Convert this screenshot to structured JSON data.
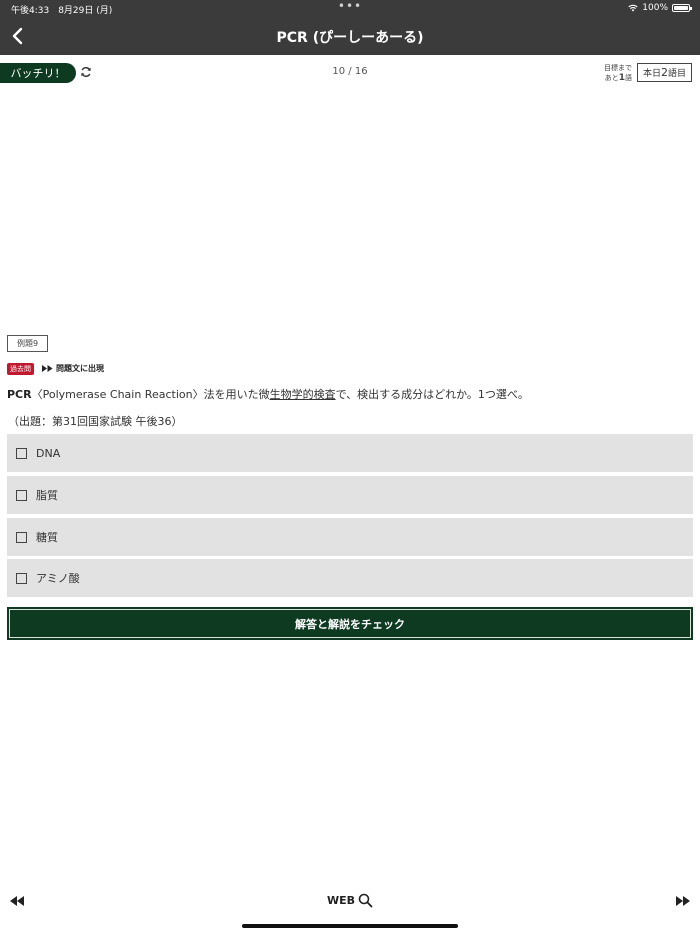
{
  "status_bar": {
    "time_date": "午後4:33　8月29日 (月)",
    "dots": "•••",
    "battery": "100%"
  },
  "nav": {
    "title": "PCR (ぴーしーあーる)"
  },
  "subbar": {
    "batchiri_label": "バッチリ！",
    "progress": "10 / 16",
    "goal_prefix": "目標まで",
    "goal_line2_a": "あと",
    "goal_remaining": "1",
    "goal_line2_b": "語",
    "today_prefix": "本日",
    "today_count": "2",
    "today_suffix": "語目"
  },
  "question": {
    "example_label": "例題9",
    "past_tag": "過去問",
    "appears_label": "問題文に出現",
    "term": "PCR",
    "text_before": "〈Polymerase Chain Reaction〉法を用いた微",
    "linked_text": "生物学的検査",
    "text_after": "で、検出する成分はどれか。1つ選べ。",
    "source": "（出題：第31回国家試験 午後36）",
    "choices": [
      "DNA",
      "脂質",
      "糖質",
      "アミノ酸"
    ],
    "check_button": "解答と解説をチェック"
  },
  "bottom": {
    "web_label": "WEB"
  },
  "colors": {
    "dark_green": "#0e3a22",
    "header_gray": "#3b3b3b",
    "choice_bg": "#e2e2e2",
    "past_tag_red": "#c0182f"
  }
}
